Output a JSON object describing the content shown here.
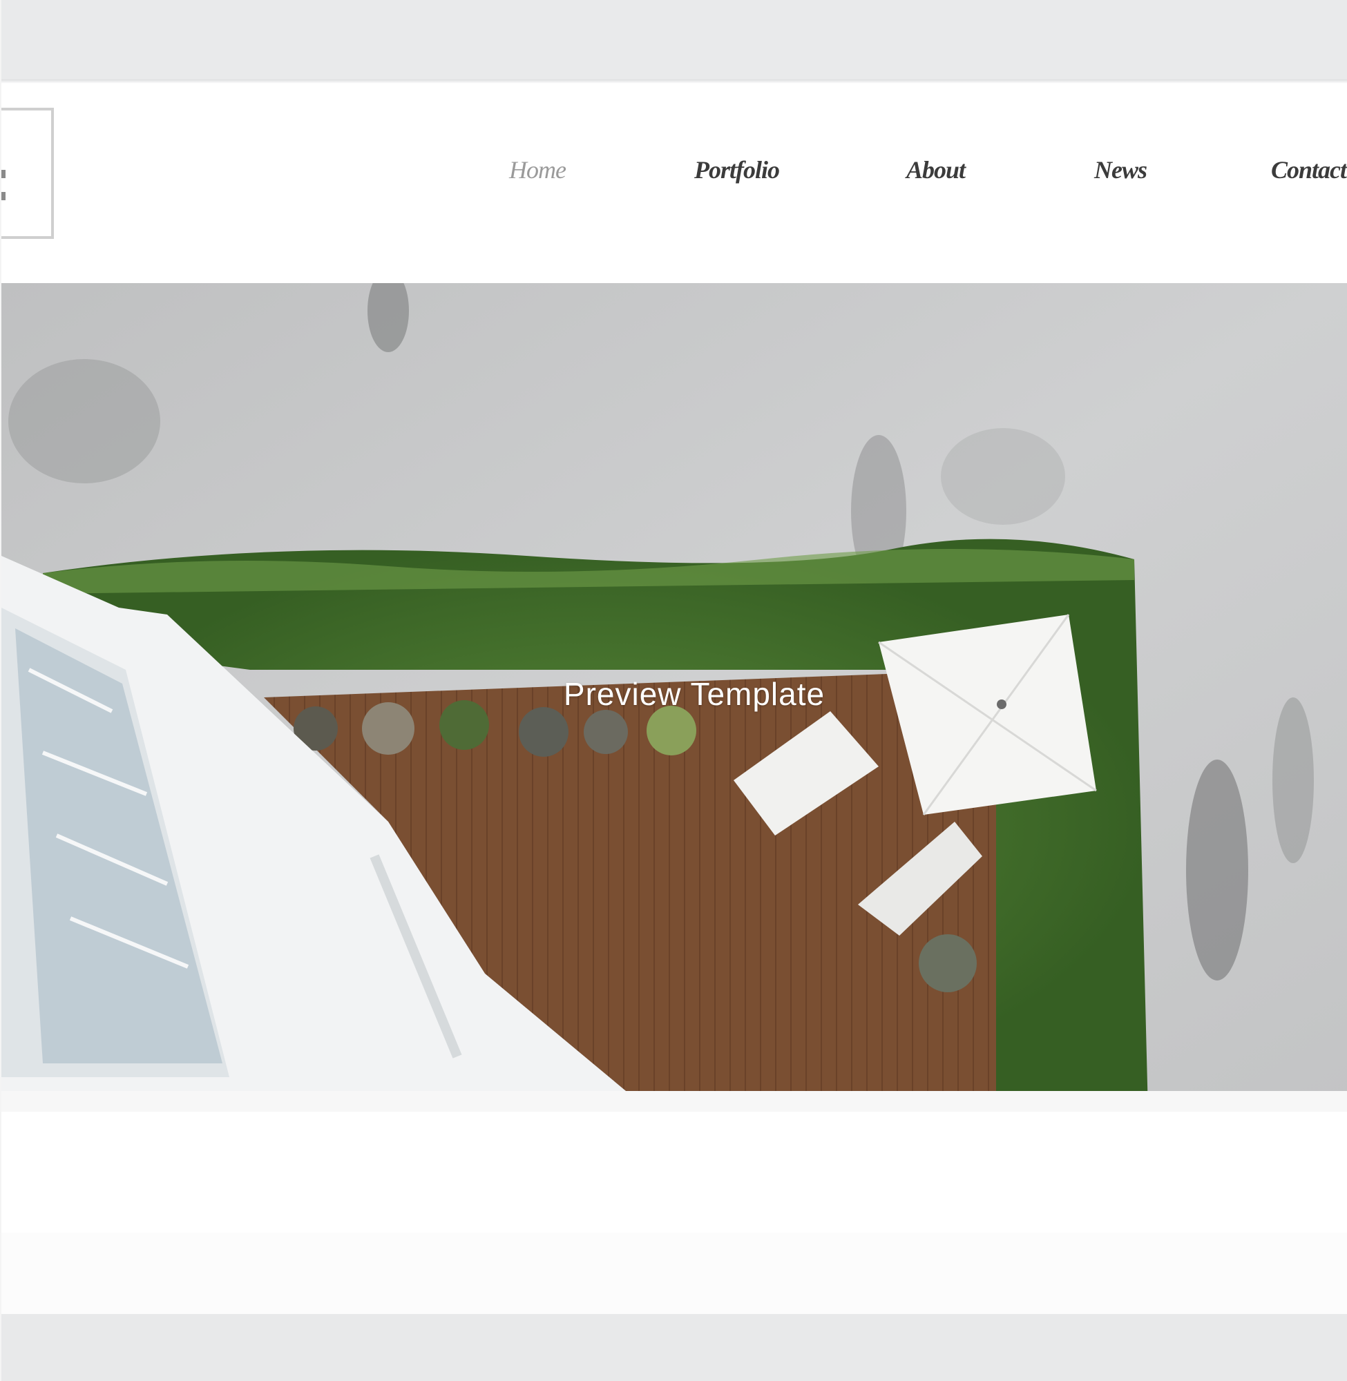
{
  "nav": {
    "items": [
      {
        "label": "Home",
        "active": true
      },
      {
        "label": "Portfolio",
        "active": false
      },
      {
        "label": "About",
        "active": false
      },
      {
        "label": "News",
        "active": false
      },
      {
        "label": "Contact",
        "active": false
      }
    ]
  },
  "hero": {
    "overlay_label": "Preview Template"
  },
  "colors": {
    "band": "#e9eaeb",
    "nav_text": "#3b3b3b",
    "nav_active": "#9a9a9a"
  }
}
